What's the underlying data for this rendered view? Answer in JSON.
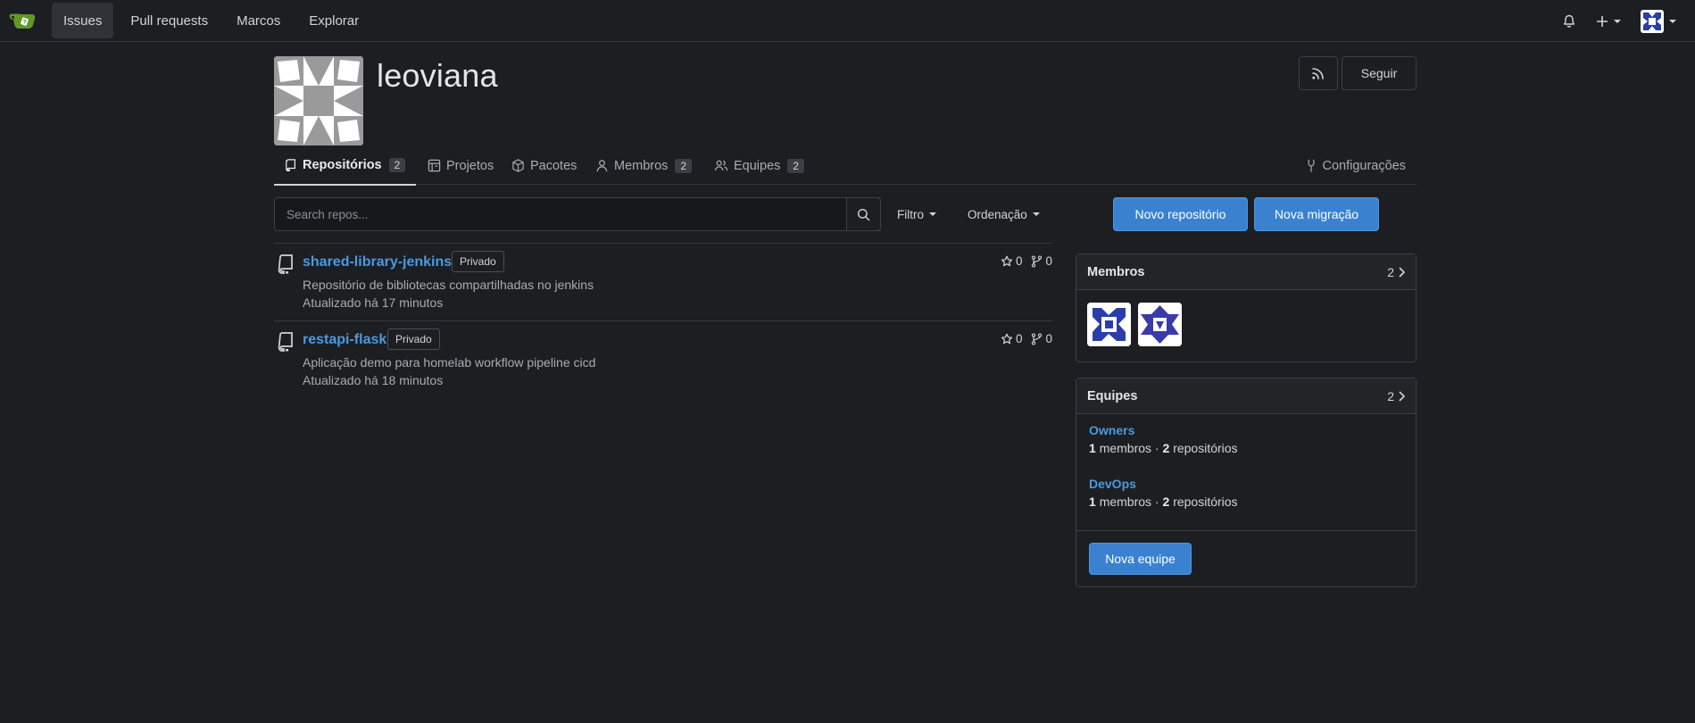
{
  "navbar": {
    "items": [
      "Issues",
      "Pull requests",
      "Marcos",
      "Explorar"
    ],
    "active_item": "Issues"
  },
  "org": {
    "name": "leoviana",
    "follow_label": "Seguir"
  },
  "tabs": [
    {
      "label": "Repositórios",
      "count": "2",
      "icon": "repo-icon"
    },
    {
      "label": "Projetos",
      "icon": "project-icon"
    },
    {
      "label": "Pacotes",
      "icon": "package-icon"
    },
    {
      "label": "Membros",
      "count": "2",
      "icon": "person-icon"
    },
    {
      "label": "Equipes",
      "count": "2",
      "icon": "people-icon"
    },
    {
      "label": "Configurações",
      "icon": "tools-icon"
    }
  ],
  "search": {
    "placeholder": "Search repos...",
    "filter_label": "Filtro",
    "sort_label": "Ordenação"
  },
  "actions": {
    "new_repo": "Novo repositório",
    "new_migration": "Nova migração"
  },
  "repos": [
    {
      "name": "shared-library-jenkins",
      "visibility": "Privado",
      "description": "Repositório de bibliotecas compartilhadas no jenkins",
      "updated": "Atualizado há 17 minutos",
      "stars": "0",
      "forks": "0"
    },
    {
      "name": "restapi-flask",
      "visibility": "Privado",
      "description": "Aplicação demo para homelab workflow pipeline cicd",
      "updated": "Atualizado há 18 minutos",
      "stars": "0",
      "forks": "0"
    }
  ],
  "members_card": {
    "title": "Membros",
    "count": "2"
  },
  "teams_card": {
    "title": "Equipes",
    "count": "2",
    "teams": [
      {
        "name": "Owners",
        "members": "1",
        "members_label": "membros",
        "repos": "2",
        "repos_label": "repositórios"
      },
      {
        "name": "DevOps",
        "members": "1",
        "members_label": "membros",
        "repos": "2",
        "repos_label": "repositórios"
      }
    ],
    "new_team": "Nova equipe"
  },
  "colors": {
    "accent": "#3a82d0",
    "link": "#4b9ae0",
    "background": "#1c1e21"
  }
}
